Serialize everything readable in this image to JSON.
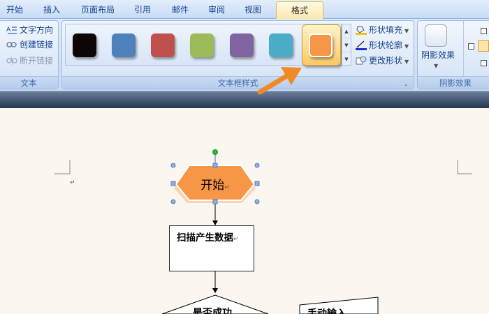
{
  "tabs": [
    {
      "label": "开始"
    },
    {
      "label": "插入"
    },
    {
      "label": "页面布局"
    },
    {
      "label": "引用"
    },
    {
      "label": "邮件"
    },
    {
      "label": "审阅"
    },
    {
      "label": "视图"
    },
    {
      "label": "格式",
      "active": true
    }
  ],
  "text_group": {
    "label": "文本",
    "commands": [
      {
        "label": "文字方向",
        "icon": "text-direction-icon"
      },
      {
        "label": "创建链接",
        "icon": "link-icon"
      },
      {
        "label": "断开链接",
        "icon": "break-link-icon",
        "disabled": true
      }
    ]
  },
  "styles_group": {
    "label": "文本框样式",
    "swatches": [
      {
        "name": "black-style",
        "color": "#0d0605"
      },
      {
        "name": "blue-style",
        "color": "#4f81bd"
      },
      {
        "name": "red-style",
        "color": "#c0504d"
      },
      {
        "name": "green-style",
        "color": "#9bbb59"
      },
      {
        "name": "purple-style",
        "color": "#8064a2"
      },
      {
        "name": "aqua-style",
        "color": "#4bacc6"
      },
      {
        "name": "orange-style",
        "color": "#f79646",
        "selected": true
      }
    ],
    "commands": [
      {
        "label": "形状填充",
        "icon": "shape-fill-icon"
      },
      {
        "label": "形状轮廓",
        "icon": "shape-outline-icon"
      },
      {
        "label": "更改形状",
        "icon": "change-shape-icon"
      }
    ]
  },
  "shadow_group": {
    "label": "阴影效果",
    "button_label": "阴影效果"
  },
  "annotation_arrow_color": "#f08a24",
  "document": {
    "start_label": "开始",
    "start_fill": "#f79646",
    "step1_label": "扫描产生数据",
    "decision_label": "是否成功",
    "manual_label": "手动输入",
    "paragraph_mark": "↵"
  }
}
